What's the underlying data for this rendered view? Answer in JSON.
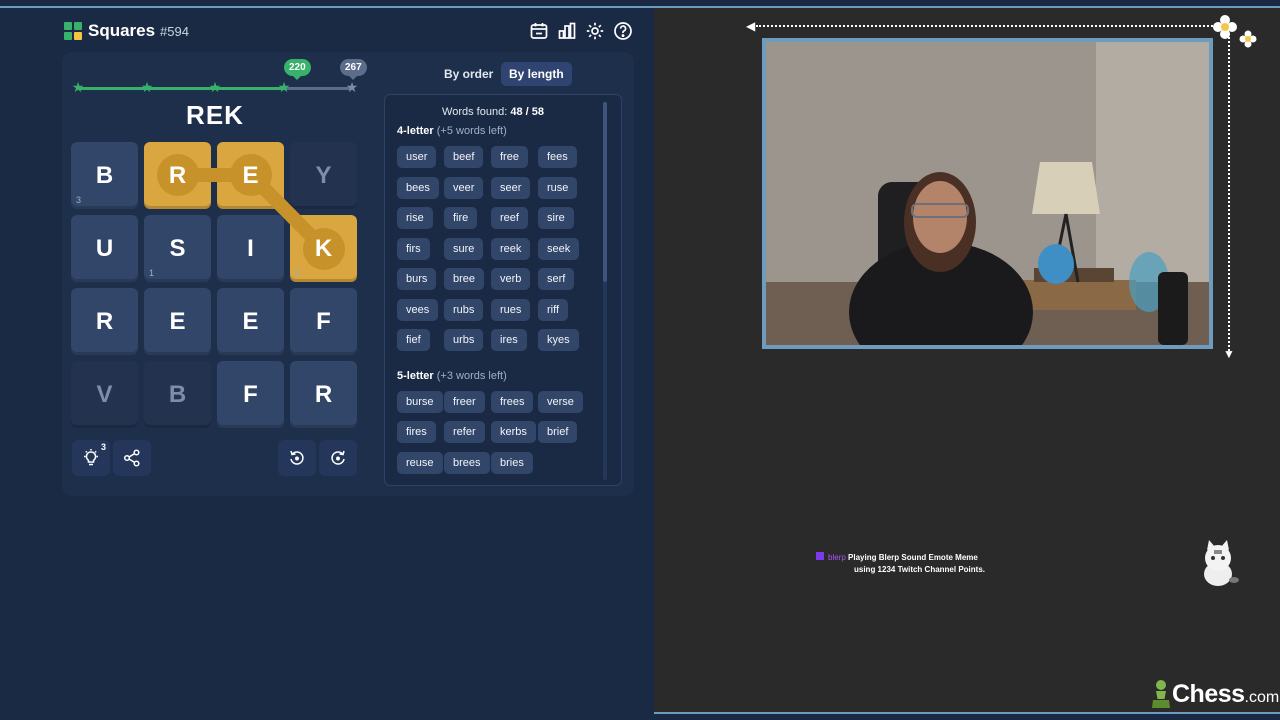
{
  "app": {
    "title": "Squares",
    "puzzle_number": "#594"
  },
  "toolbar_icons": [
    "calendar-icon",
    "stats-icon",
    "gear-icon",
    "help-icon"
  ],
  "progress": {
    "fraction": 0.76,
    "score_current": "220",
    "score_max": "267"
  },
  "current_word": "REK",
  "grid": [
    {
      "letter": "B",
      "sub": "3",
      "state": "normal"
    },
    {
      "letter": "R",
      "sub": "",
      "state": "selected"
    },
    {
      "letter": "E",
      "sub": "",
      "state": "selected"
    },
    {
      "letter": "Y",
      "sub": "",
      "state": "dim"
    },
    {
      "letter": "U",
      "sub": "",
      "state": "normal"
    },
    {
      "letter": "S",
      "sub": "1",
      "state": "normal"
    },
    {
      "letter": "I",
      "sub": "",
      "state": "normal"
    },
    {
      "letter": "K",
      "sub": "2",
      "state": "selected"
    },
    {
      "letter": "R",
      "sub": "",
      "state": "normal"
    },
    {
      "letter": "E",
      "sub": "",
      "state": "normal"
    },
    {
      "letter": "E",
      "sub": "",
      "state": "normal"
    },
    {
      "letter": "F",
      "sub": "",
      "state": "normal"
    },
    {
      "letter": "V",
      "sub": "",
      "state": "dim"
    },
    {
      "letter": "B",
      "sub": "",
      "state": "dim"
    },
    {
      "letter": "F",
      "sub": "",
      "state": "normal"
    },
    {
      "letter": "R",
      "sub": "",
      "state": "normal"
    }
  ],
  "hints_remaining": "3",
  "sort": {
    "by_order": "By order",
    "by_length": "By length"
  },
  "words_found": {
    "label": "Words found:",
    "value": "48 / 58"
  },
  "groups": [
    {
      "title": "4-letter",
      "left": "(+5 words left)",
      "words": [
        "user",
        "beef",
        "free",
        "fees",
        "bees",
        "veer",
        "seer",
        "ruse",
        "rise",
        "fire",
        "reef",
        "sire",
        "firs",
        "sure",
        "reek",
        "seek",
        "burs",
        "bree",
        "verb",
        "serf",
        "vees",
        "rubs",
        "rues",
        "riff",
        "fief",
        "urbs",
        "ires",
        "kyes"
      ]
    },
    {
      "title": "5-letter",
      "left": "(+3 words left)",
      "words": [
        "burse",
        "freer",
        "frees",
        "verse",
        "fires",
        "refer",
        "kerbs",
        "brief",
        "reuse",
        "brees",
        "bries"
      ]
    }
  ],
  "alert": {
    "username": "blerp",
    "line1": "Playing Blerp Sound Emote Meme",
    "line2": "using 1234 Twitch Channel Points."
  },
  "brand": {
    "name": "Chess",
    "tld": ".com"
  },
  "colors": {
    "accent_gold": "#d9a640",
    "progress_green": "#38b26b",
    "panel_navy": "#1e2f4c",
    "frame_blue": "#6f9bbf"
  }
}
